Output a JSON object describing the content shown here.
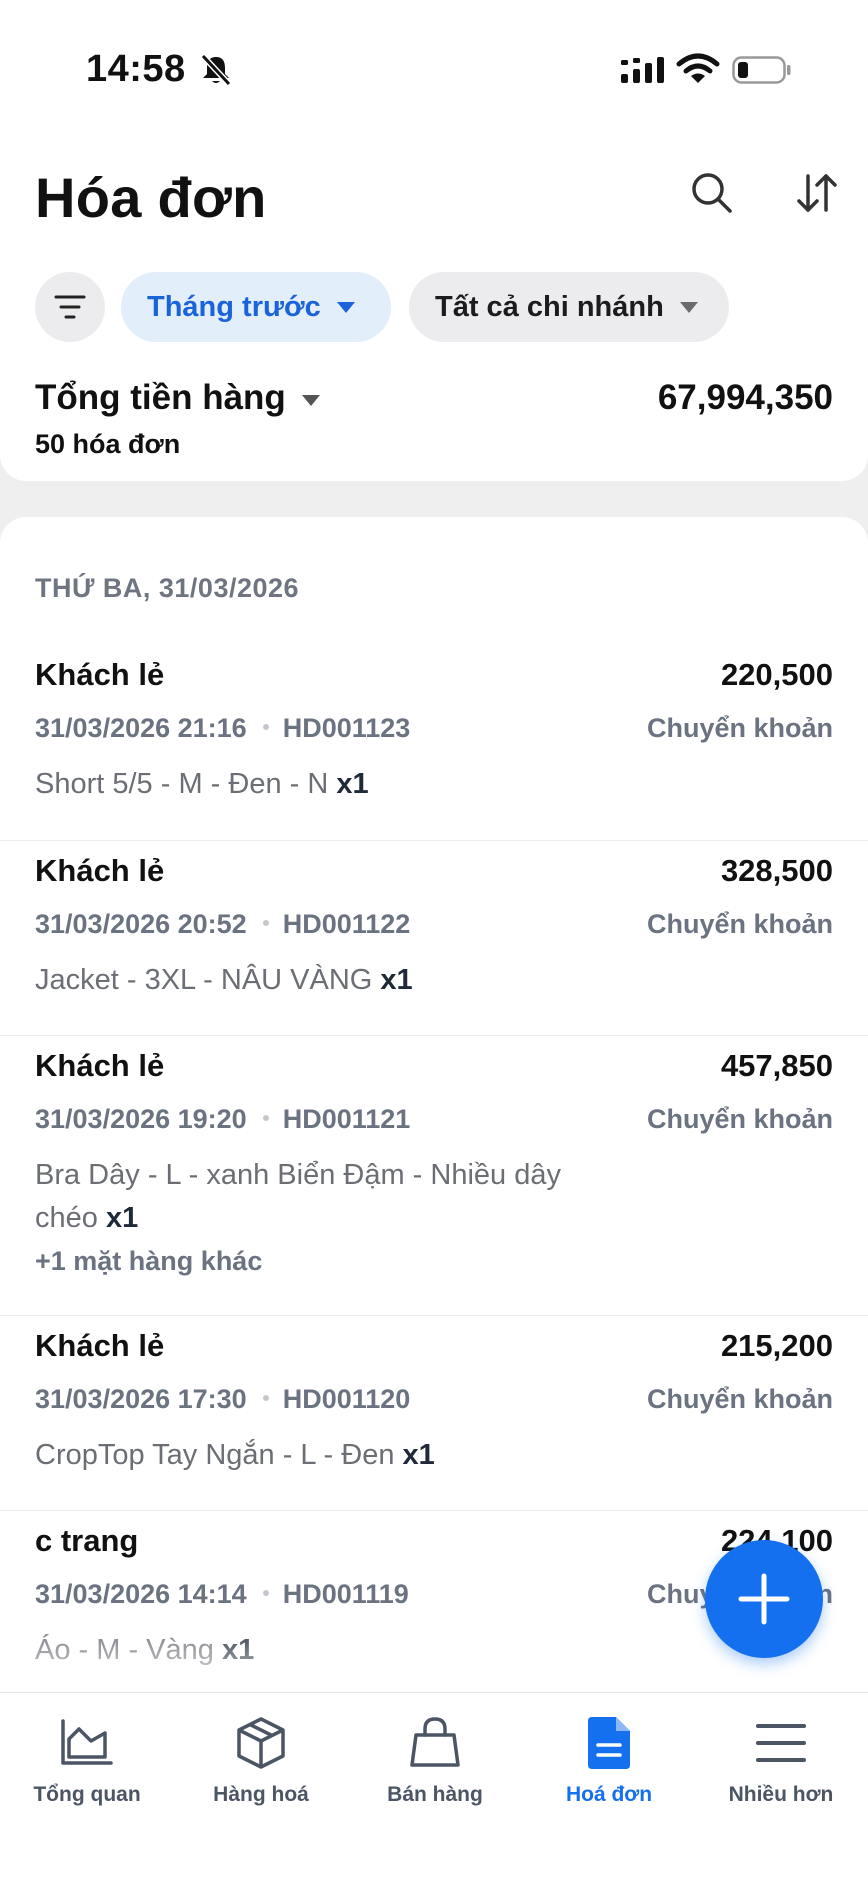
{
  "status_bar": {
    "time": "14:58"
  },
  "header": {
    "title": "Hóa đơn"
  },
  "filters": {
    "period": "Tháng trước",
    "branch": "Tất cả chi nhánh"
  },
  "summary": {
    "label": "Tổng tiền hàng",
    "count": "50 hóa đơn",
    "total": "67,994,350"
  },
  "list": {
    "date_header": "THỨ BA, 31/03/2026",
    "invoices": [
      {
        "customer": "Khách lẻ",
        "amount": "220,500",
        "datetime": "31/03/2026 21:16",
        "code": "HD001123",
        "payment": "Chuyển khoản",
        "item": "Short 5/5 - M - Đen - N",
        "qty": "x1"
      },
      {
        "customer": "Khách lẻ",
        "amount": "328,500",
        "datetime": "31/03/2026 20:52",
        "code": "HD001122",
        "payment": "Chuyển khoản",
        "item": "Jacket - 3XL - NÂU VÀNG",
        "qty": "x1"
      },
      {
        "customer": "Khách lẻ",
        "amount": "457,850",
        "datetime": "31/03/2026 19:20",
        "code": "HD001121",
        "payment": "Chuyển khoản",
        "item": "Bra Dây - L - xanh Biển Đậm - Nhiều dây chéo",
        "qty": "x1",
        "more": "+1 mặt hàng khác"
      },
      {
        "customer": "Khách lẻ",
        "amount": "215,200",
        "datetime": "31/03/2026 17:30",
        "code": "HD001120",
        "payment": "Chuyển khoản",
        "item": "CropTop Tay Ngắn - L - Đen",
        "qty": "x1"
      },
      {
        "customer": "c trang",
        "amount": "224,100",
        "datetime": "31/03/2026 14:14",
        "code": "HD001119",
        "payment": "Chuyển khoản",
        "item": "Áo - M - Vàng",
        "qty": "x1"
      }
    ]
  },
  "bottom_nav": [
    {
      "label": "Tổng quan",
      "icon": "chart-icon"
    },
    {
      "label": "Hàng hoá",
      "icon": "box-icon"
    },
    {
      "label": "Bán hàng",
      "icon": "shopping-bag-icon"
    },
    {
      "label": "Hoá đơn",
      "icon": "document-icon",
      "active": true
    },
    {
      "label": "Nhiều hơn",
      "icon": "menu-icon"
    }
  ],
  "colors": {
    "accent": "#1570ef",
    "chip_active_bg": "#e3eefb",
    "muted_text": "#6b7280"
  }
}
